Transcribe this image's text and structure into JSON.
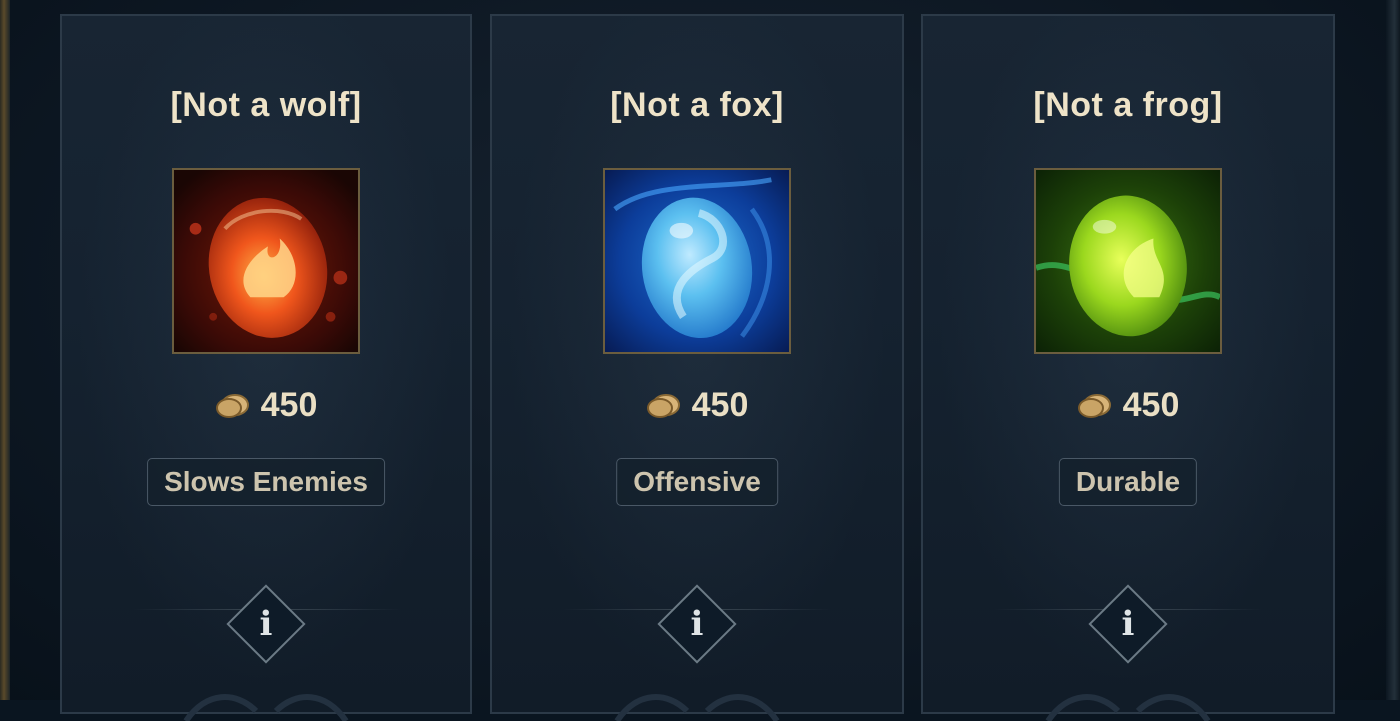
{
  "cards": [
    {
      "title": "[Not a wolf]",
      "price": "450",
      "tag": "Slows Enemies",
      "icon": "fire-egg-icon",
      "accent": "#e0461a",
      "info": "i"
    },
    {
      "title": "[Not a fox]",
      "price": "450",
      "tag": "Offensive",
      "icon": "water-egg-icon",
      "accent": "#2f8ee0",
      "info": "i"
    },
    {
      "title": "[Not a frog]",
      "price": "450",
      "tag": "Durable",
      "icon": "leaf-egg-icon",
      "accent": "#8ed11c",
      "info": "i"
    }
  ],
  "currency_icon": "gold-coin-icon",
  "colors": {
    "background": "#0c1621",
    "card_border": "#2c3a48",
    "title_text": "#eee3c8",
    "gold": "#c9a466"
  }
}
